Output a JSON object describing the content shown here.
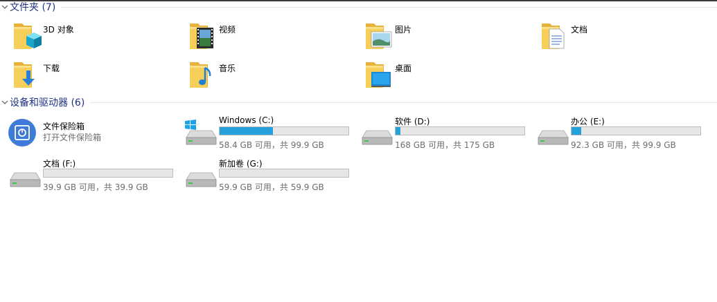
{
  "sections": {
    "folders": {
      "title": "文件夹 (7)"
    },
    "devices": {
      "title": "设备和驱动器 (6)"
    }
  },
  "folders": [
    {
      "label": "3D 对象",
      "icon": "3d-objects-folder-icon"
    },
    {
      "label": "视频",
      "icon": "videos-folder-icon"
    },
    {
      "label": "图片",
      "icon": "pictures-folder-icon"
    },
    {
      "label": "文档",
      "icon": "documents-folder-icon"
    },
    {
      "label": "下载",
      "icon": "downloads-folder-icon"
    },
    {
      "label": "音乐",
      "icon": "music-folder-icon"
    },
    {
      "label": "桌面",
      "icon": "desktop-folder-icon"
    }
  ],
  "vault": {
    "name": "文件保险箱",
    "subtitle": "打开文件保险箱",
    "icon": "vault-icon"
  },
  "drives": [
    {
      "name": "Windows (C:)",
      "capacity": "58.4 GB 可用，共 99.9 GB",
      "used_fraction": 0.415,
      "icon": "windows-drive-icon"
    },
    {
      "name": "软件 (D:)",
      "capacity": "168 GB 可用，共 175 GB",
      "used_fraction": 0.04,
      "icon": "hard-drive-icon"
    },
    {
      "name": "办公 (E:)",
      "capacity": "92.3 GB 可用，共 99.9 GB",
      "used_fraction": 0.076,
      "icon": "hard-drive-icon"
    },
    {
      "name": "文档 (F:)",
      "capacity": "39.9 GB 可用，共 39.9 GB",
      "used_fraction": 0.0,
      "icon": "hard-drive-icon"
    },
    {
      "name": "新加卷 (G:)",
      "capacity": "59.9 GB 可用，共 59.9 GB",
      "used_fraction": 0.0,
      "icon": "hard-drive-icon"
    }
  ],
  "colors": {
    "accent": "#26a0da",
    "section_title": "#1e3287",
    "secondary_text": "#6d6d6d",
    "folder": "#f0c34f"
  }
}
